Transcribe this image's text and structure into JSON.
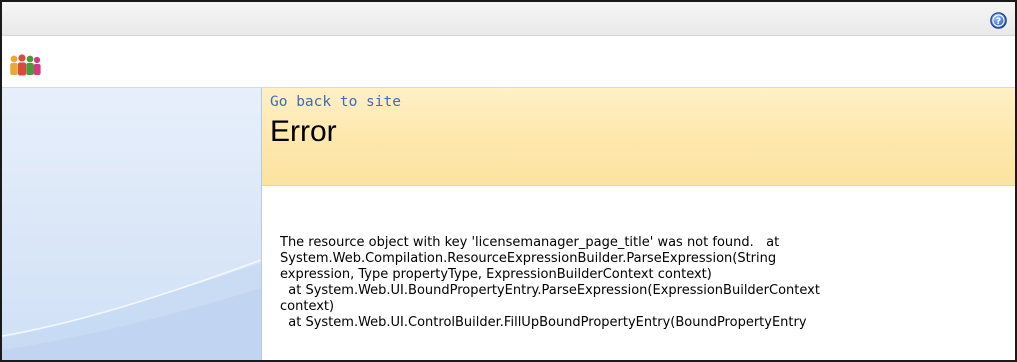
{
  "header": {
    "help_icon": "help-icon"
  },
  "titlebar": {
    "logo_icon": "people-group-icon"
  },
  "main": {
    "back_link": "Go back to site",
    "title": "Error",
    "error_lines": [
      "The resource object with key 'licensemanager_page_title' was not found.   at",
      "System.Web.Compilation.ResourceExpressionBuilder.ParseExpression(String",
      "expression, Type propertyType, ExpressionBuilderContext context)",
      "  at System.Web.UI.BoundPropertyEntry.ParseExpression(ExpressionBuilderContext",
      "context)",
      "  at System.Web.UI.ControlBuilder.FillUpBoundPropertyEntry(BoundPropertyEntry"
    ]
  },
  "colors": {
    "header_band": "#fde7ab",
    "link": "#3d6db4",
    "nav_background": "#dce8f8",
    "border": "#1a1a1a"
  }
}
